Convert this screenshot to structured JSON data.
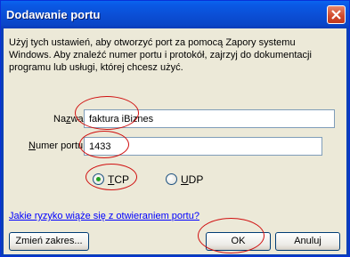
{
  "window": {
    "title": "Dodawanie portu"
  },
  "description": "Użyj tych ustawień, aby otworzyć port za pomocą Zapory systemu Windows. Aby znaleźć numer portu i protokół, zajrzyj do dokumentacji programu lub usługi, której chcesz użyć.",
  "name_field": {
    "label_pre": "Na",
    "label_key": "z",
    "label_post": "wa:",
    "value": "faktura iBiznes"
  },
  "port_field": {
    "label_key": "N",
    "label_post": "umer portu:",
    "value": "1433"
  },
  "protocol": {
    "tcp": {
      "key": "T",
      "rest": "CP",
      "selected": true
    },
    "udp": {
      "key": "U",
      "rest": "DP",
      "selected": false
    }
  },
  "risk_link": "Jakie ryzyko wiąże się z otwieraniem portu?",
  "buttons": {
    "change_scope": "Zmień zakres...",
    "ok": "OK",
    "cancel": "Anuluj"
  },
  "annotation_color": "#d01010"
}
